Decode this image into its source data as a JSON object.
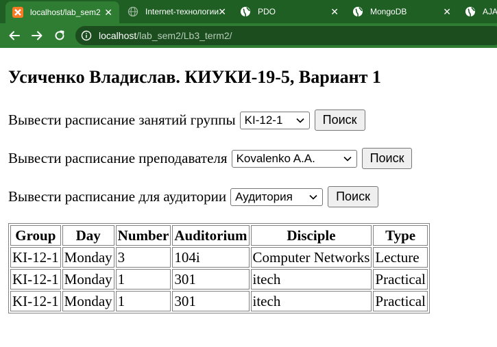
{
  "browser": {
    "tabs": [
      {
        "title": "localhost/lab_sem2",
        "icon": "xampp-icon",
        "active": true
      },
      {
        "title": "Internet-технологии",
        "icon": "globe-icon",
        "active": false
      },
      {
        "title": "PDO",
        "icon": "globe-icon",
        "active": false
      },
      {
        "title": "MongoDB",
        "icon": "globe-icon",
        "active": false
      },
      {
        "title": "AJAX",
        "icon": "globe-icon",
        "active": false
      }
    ],
    "url_host": "localhost",
    "url_path": "/lab_sem2/Lb3_term2/",
    "accent": "#2e7d32",
    "tabstrip_color": "#1f5f24"
  },
  "page": {
    "heading": "Усиченко Владислав. КИУКИ-19-5, Вариант 1",
    "forms": [
      {
        "label": "Вывести расписание занятий группы",
        "select_value": "KI-12-1",
        "button": "Поиск"
      },
      {
        "label": "Вывести расписание преподавателя",
        "select_value": "Kovalenko A.A.",
        "button": "Поиск"
      },
      {
        "label": "Вывести расписание для аудитории",
        "select_value": "Аудитория",
        "button": "Поиск"
      }
    ],
    "table": {
      "headers": [
        "Group",
        "Day",
        "Number",
        "Auditorium",
        "Disciple",
        "Type"
      ],
      "rows": [
        [
          "KI-12-1",
          "Monday",
          "3",
          "104i",
          "Computer Networks",
          "Lecture"
        ],
        [
          "KI-12-1",
          "Monday",
          "1",
          "301",
          "itech",
          "Practical"
        ],
        [
          "KI-12-1",
          "Monday",
          "1",
          "301",
          "itech",
          "Practical"
        ]
      ]
    }
  }
}
